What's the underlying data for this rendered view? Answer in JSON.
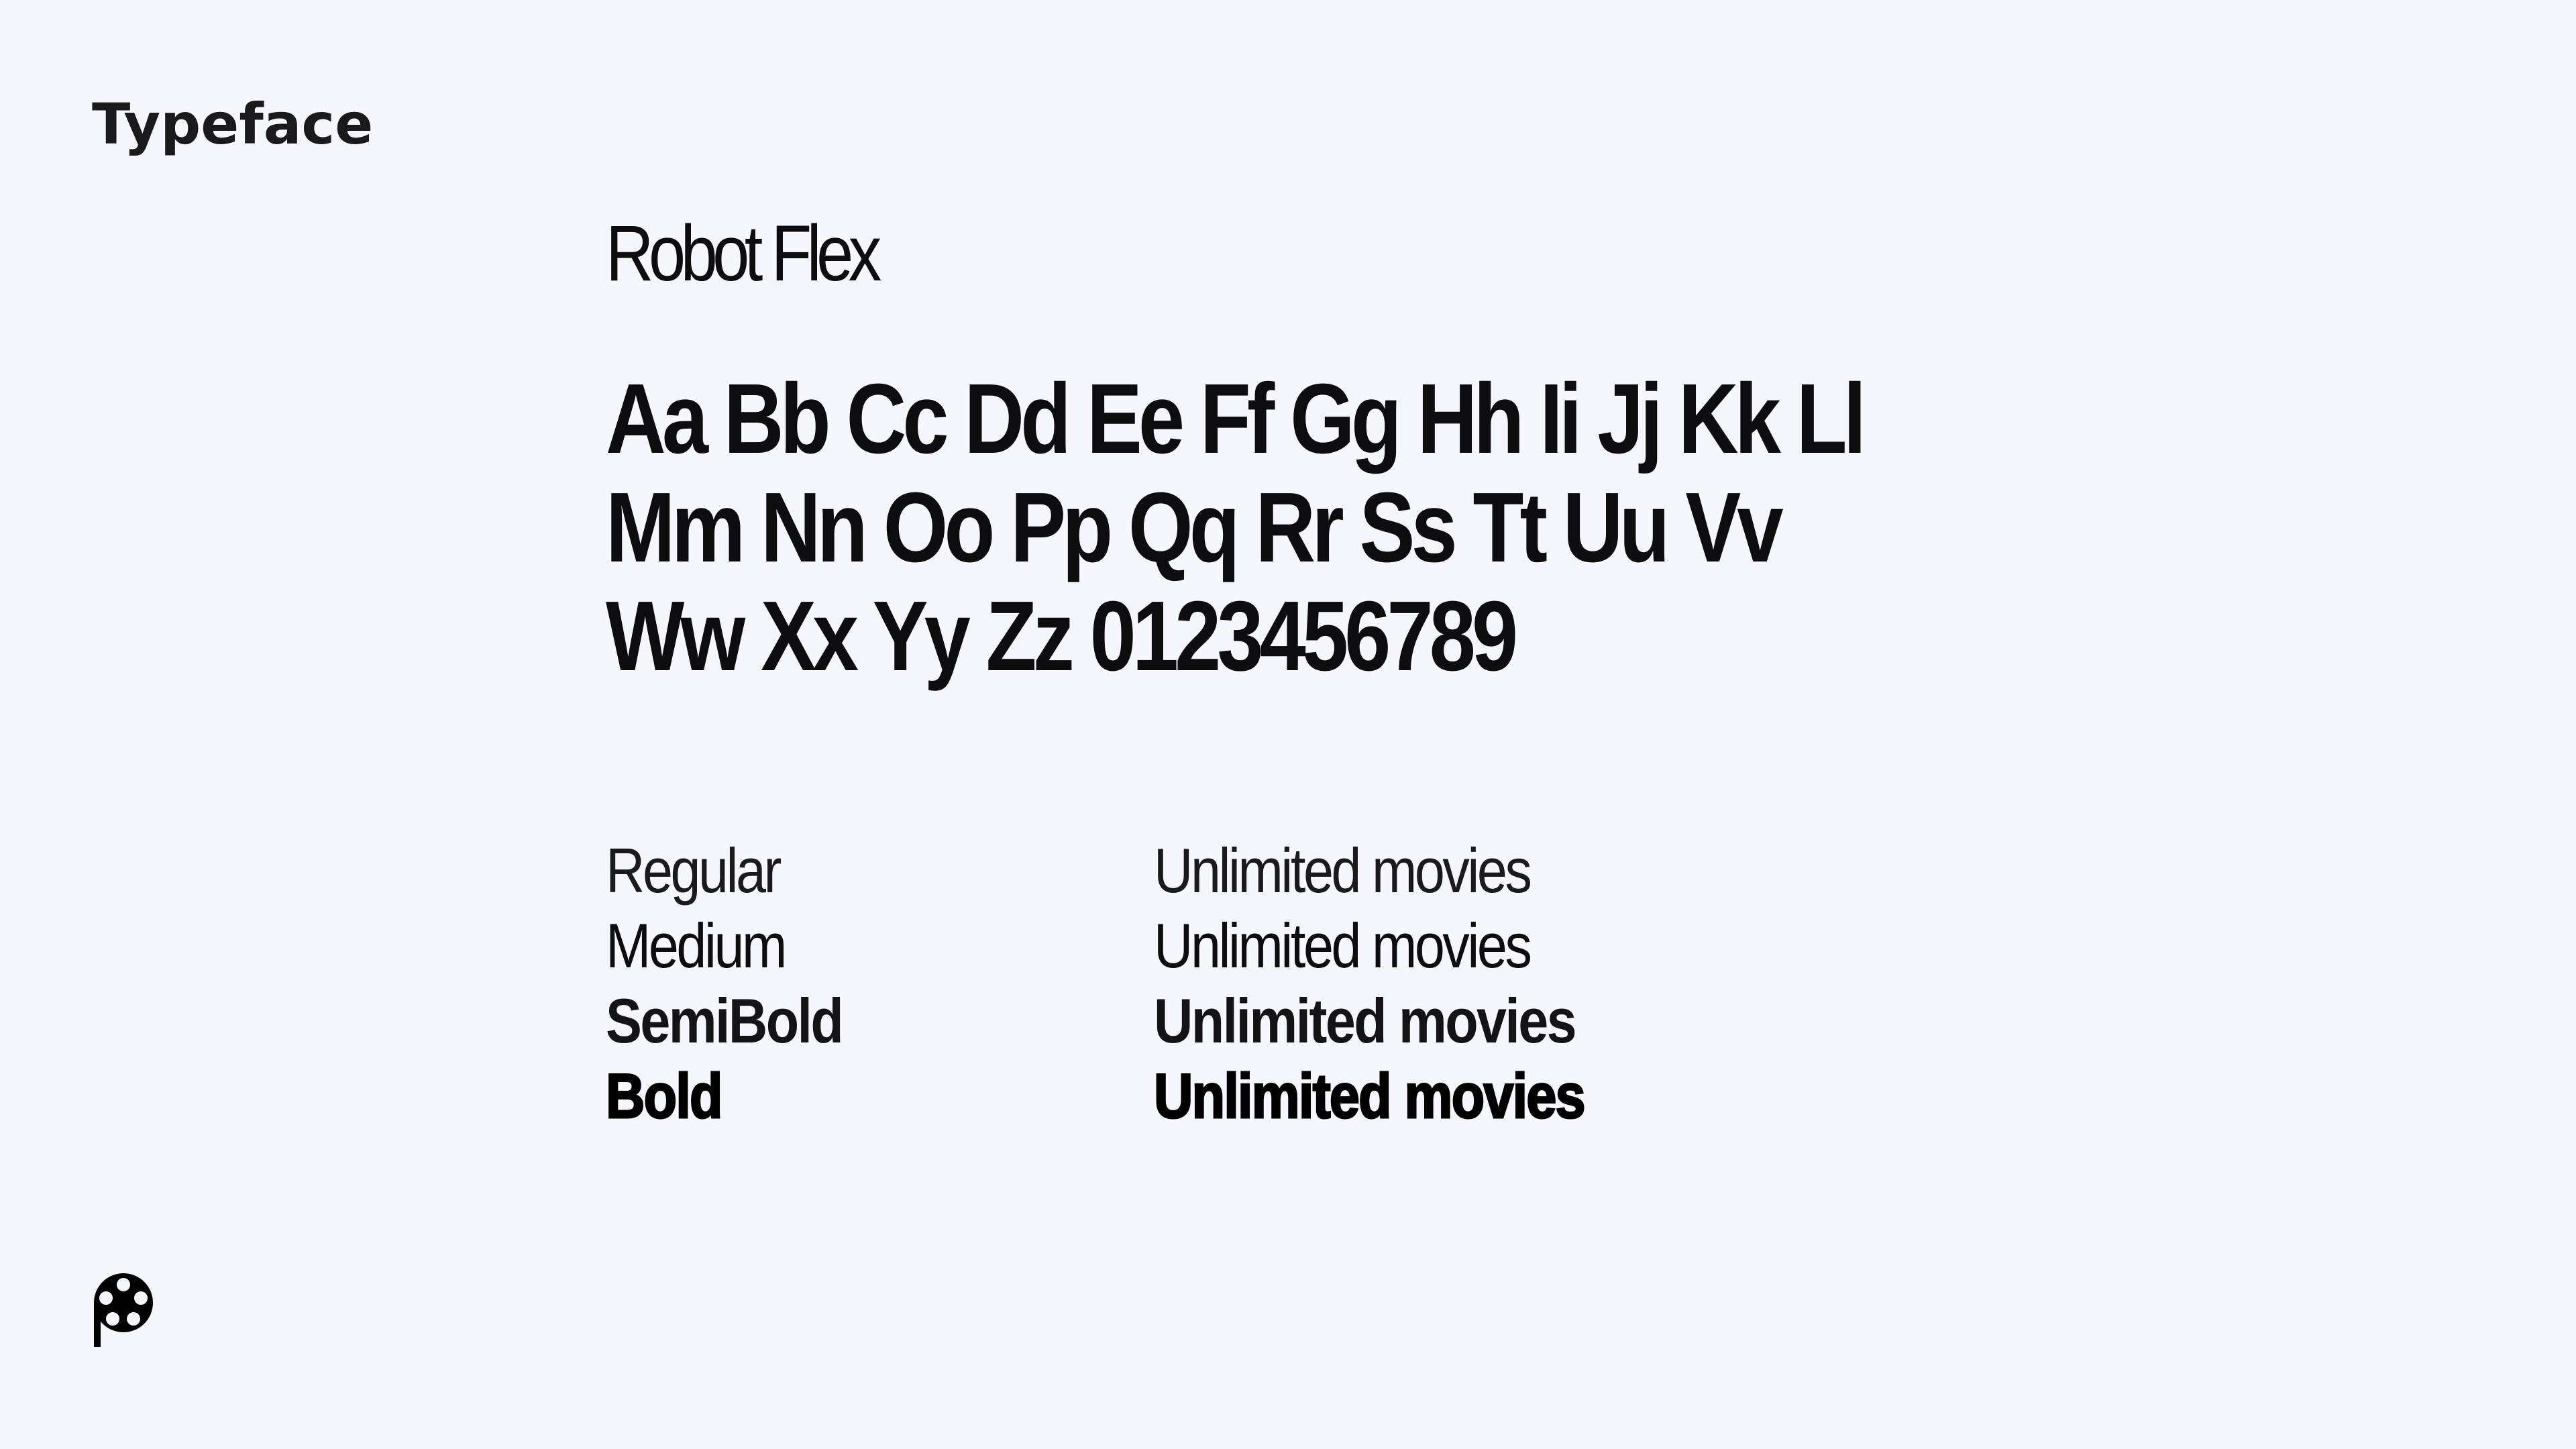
{
  "heading": "Typeface",
  "font_name": "Robot Flex",
  "specimen_lines": [
    "Aa Bb Cc Dd Ee Ff Gg Hh Ii Jj Kk Ll",
    "Mm Nn Oo Pp Qq Rr Ss Tt Uu Vv",
    "Ww Xx Yy Zz 0123456789"
  ],
  "weights": [
    {
      "name": "Regular",
      "sample": "Unlimited movies"
    },
    {
      "name": "Medium",
      "sample": "Unlimited movies"
    },
    {
      "name": "SemiBold",
      "sample": "Unlimited movies"
    },
    {
      "name": "Bold",
      "sample": "Unlimited movies"
    }
  ],
  "logo": {
    "icon": "film-reel-logo-icon",
    "color": "#000000"
  },
  "colors": {
    "background": "#f5f7fc",
    "text": "#0d0d0f"
  }
}
